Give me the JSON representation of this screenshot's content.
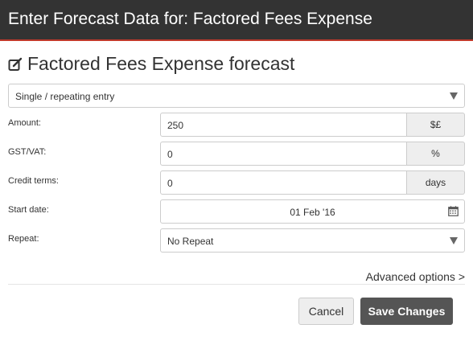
{
  "dialog": {
    "title": "Enter Forecast Data for: Factored Fees Expense",
    "accent_color": "#c0392b",
    "header_bg": "#333333"
  },
  "heading": {
    "icon": "edit-icon",
    "text": "Factored Fees Expense forecast"
  },
  "entry_type": {
    "selected": "Single / repeating entry"
  },
  "fields": {
    "amount": {
      "label": "Amount:",
      "value": "250",
      "addon": "$£"
    },
    "gst_vat": {
      "label": "GST/VAT:",
      "value": "0",
      "addon": "%"
    },
    "credit_terms": {
      "label": "Credit terms:",
      "value": "0",
      "addon": "days"
    },
    "start_date": {
      "label": "Start date:",
      "value": "01 Feb '16",
      "icon": "calendar-icon"
    },
    "repeat": {
      "label": "Repeat:",
      "selected": "No Repeat"
    }
  },
  "advanced": {
    "label": "Advanced options >"
  },
  "buttons": {
    "cancel": "Cancel",
    "save": "Save Changes",
    "save_color": "#555555"
  }
}
